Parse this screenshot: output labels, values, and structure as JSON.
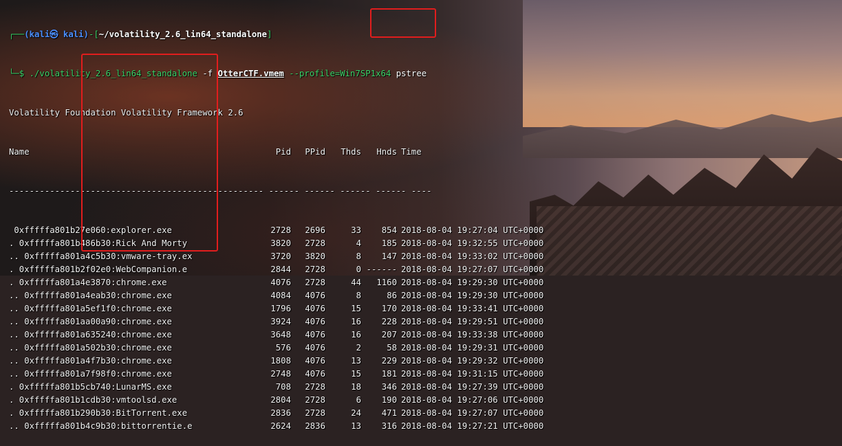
{
  "prompt": {
    "user_host": "(kali㉿ kali)",
    "open": "┌──",
    "dash": "-[",
    "cwd": "~/volatility_2.6_lin64_standalone",
    "close": "]",
    "prompt_mark": "└─$",
    "command": "./volatility_2.6_lin64_standalone",
    "flag_f": "-f",
    "file": "OtterCTF.vmem",
    "profile": "--profile=Win7SP1x64",
    "plugin": "pstree"
  },
  "banner": "Volatility Foundation Volatility Framework 2.6",
  "columns": {
    "name": "Name",
    "pid": "Pid",
    "ppid": "PPid",
    "thds": "Thds",
    "hnds": "Hnds",
    "time": "Time"
  },
  "separator": "-------------------------------------------------- ------ ------ ------ ------ ----",
  "rows": [
    {
      "name": " 0xfffffa801b27e060:explorer.exe",
      "pid": "2728",
      "ppid": "2696",
      "thds": "33",
      "hnds": "854",
      "time": "2018-08-04 19:27:04 UTC+0000"
    },
    {
      "name": ". 0xfffffa801b486b30:Rick And Morty",
      "pid": "3820",
      "ppid": "2728",
      "thds": "4",
      "hnds": "185",
      "time": "2018-08-04 19:32:55 UTC+0000"
    },
    {
      "name": ".. 0xfffffa801a4c5b30:vmware-tray.ex",
      "pid": "3720",
      "ppid": "3820",
      "thds": "8",
      "hnds": "147",
      "time": "2018-08-04 19:33:02 UTC+0000"
    },
    {
      "name": ". 0xfffffa801b2f02e0:WebCompanion.e",
      "pid": "2844",
      "ppid": "2728",
      "thds": "0",
      "hnds": "------",
      "time": "2018-08-04 19:27:07 UTC+0000"
    },
    {
      "name": ". 0xfffffa801a4e3870:chrome.exe",
      "pid": "4076",
      "ppid": "2728",
      "thds": "44",
      "hnds": "1160",
      "time": "2018-08-04 19:29:30 UTC+0000"
    },
    {
      "name": ".. 0xfffffa801a4eab30:chrome.exe",
      "pid": "4084",
      "ppid": "4076",
      "thds": "8",
      "hnds": "86",
      "time": "2018-08-04 19:29:30 UTC+0000"
    },
    {
      "name": ".. 0xfffffa801a5ef1f0:chrome.exe",
      "pid": "1796",
      "ppid": "4076",
      "thds": "15",
      "hnds": "170",
      "time": "2018-08-04 19:33:41 UTC+0000"
    },
    {
      "name": ".. 0xfffffa801aa00a90:chrome.exe",
      "pid": "3924",
      "ppid": "4076",
      "thds": "16",
      "hnds": "228",
      "time": "2018-08-04 19:29:51 UTC+0000"
    },
    {
      "name": ".. 0xfffffa801a635240:chrome.exe",
      "pid": "3648",
      "ppid": "4076",
      "thds": "16",
      "hnds": "207",
      "time": "2018-08-04 19:33:38 UTC+0000"
    },
    {
      "name": ".. 0xfffffa801a502b30:chrome.exe",
      "pid": "576",
      "ppid": "4076",
      "thds": "2",
      "hnds": "58",
      "time": "2018-08-04 19:29:31 UTC+0000"
    },
    {
      "name": ".. 0xfffffa801a4f7b30:chrome.exe",
      "pid": "1808",
      "ppid": "4076",
      "thds": "13",
      "hnds": "229",
      "time": "2018-08-04 19:29:32 UTC+0000"
    },
    {
      "name": ".. 0xfffffa801a7f98f0:chrome.exe",
      "pid": "2748",
      "ppid": "4076",
      "thds": "15",
      "hnds": "181",
      "time": "2018-08-04 19:31:15 UTC+0000"
    },
    {
      "name": ". 0xfffffa801b5cb740:LunarMS.exe",
      "pid": "708",
      "ppid": "2728",
      "thds": "18",
      "hnds": "346",
      "time": "2018-08-04 19:27:39 UTC+0000"
    },
    {
      "name": ". 0xfffffa801b1cdb30:vmtoolsd.exe",
      "pid": "2804",
      "ppid": "2728",
      "thds": "6",
      "hnds": "190",
      "time": "2018-08-04 19:27:06 UTC+0000"
    },
    {
      "name": ". 0xfffffa801b290b30:BitTorrent.exe",
      "pid": "2836",
      "ppid": "2728",
      "thds": "24",
      "hnds": "471",
      "time": "2018-08-04 19:27:07 UTC+0000"
    },
    {
      "name": ".. 0xfffffa801b4c9b30:bittorrentie.e",
      "pid": "2624",
      "ppid": "2836",
      "thds": "13",
      "hnds": "316",
      "time": "2018-08-04 19:27:21 UTC+0000"
    }
  ],
  "colors": {
    "prompt_green": "#3fd46a",
    "path_blue": "#4c8fff",
    "highlight_red": "#e11d1d"
  }
}
